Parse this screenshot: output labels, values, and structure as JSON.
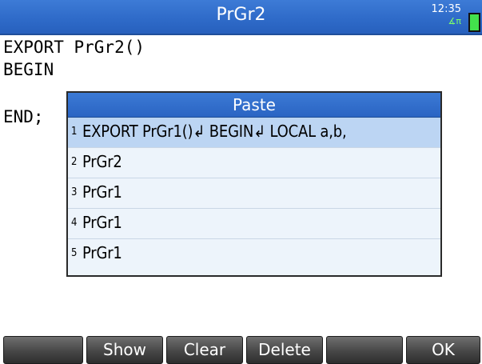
{
  "title_bar": {
    "title": "PrGr2",
    "time": "12:35",
    "mode_indicator": "∡π",
    "battery_icon": "battery-icon"
  },
  "editor": {
    "lines": [
      "EXPORT PrGr2()",
      "BEGIN",
      "END;"
    ]
  },
  "paste_dialog": {
    "title": "Paste",
    "items": [
      {
        "number": "1",
        "text": "EXPORT PrGr1()↲ BEGIN↲ LOCAL a,b,",
        "selected": true
      },
      {
        "number": "2",
        "text": "PrGr2",
        "selected": false
      },
      {
        "number": "3",
        "text": "PrGr1",
        "selected": false
      },
      {
        "number": "4",
        "text": "PrGr1",
        "selected": false
      },
      {
        "number": "5",
        "text": "PrGr1",
        "selected": false
      }
    ]
  },
  "softkeys": [
    "",
    "Show",
    "Clear",
    "Delete",
    "",
    "OK"
  ],
  "colors": {
    "title_bar": "#2f6bc9",
    "dialog_header": "#2f6bc9",
    "selected_row": "#bcd5f3",
    "softkey": "#4a4a4a",
    "battery": "#43e24c"
  }
}
